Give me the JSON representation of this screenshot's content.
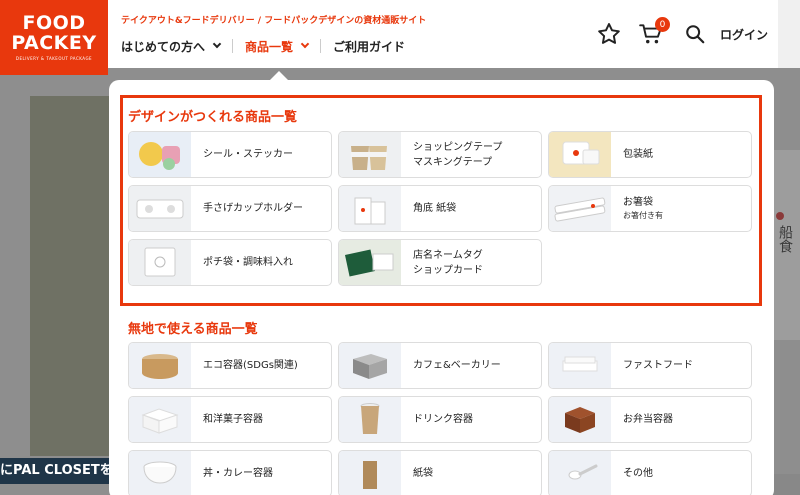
{
  "logo": {
    "line1": "FOOD",
    "line2": "PACKEY",
    "tagline": "DELIVERY & TAKEOUT PACKAGE"
  },
  "header": {
    "tagline": "テイクアウト&フードデリバリー / フードパックデザインの資材通販サイト",
    "nav": [
      {
        "label": "はじめての方へ",
        "has_chevron": true,
        "active": false
      },
      {
        "label": "商品一覧",
        "has_chevron": true,
        "active": true
      },
      {
        "label": "ご利用ガイド",
        "has_chevron": false,
        "active": false
      }
    ],
    "cart_count": "0",
    "login_label": "ログイン",
    "icons": {
      "favorite": "star-icon",
      "cart": "cart-icon",
      "search": "search-icon"
    }
  },
  "menu": {
    "design_title": "デザインがつくれる商品一覧",
    "design_items": [
      {
        "label": "シール・ステッカー"
      },
      {
        "label": "ショッピングテープ",
        "sub": "マスキングテープ"
      },
      {
        "label": "包装紙"
      },
      {
        "label": "手さげカップホルダー"
      },
      {
        "label": "角底 紙袋"
      },
      {
        "label": "お箸袋",
        "sub": "お箸付き有"
      },
      {
        "label": "ポチ袋・調味料入れ"
      },
      {
        "label": "店名ネームタグ",
        "sub": "ショップカード"
      }
    ],
    "plain_title": "無地で使える商品一覧",
    "plain_items": [
      {
        "label": "エコ容器(SDGs関連)"
      },
      {
        "label": "カフェ&ベーカリー"
      },
      {
        "label": "ファストフード"
      },
      {
        "label": "和洋菓子容器"
      },
      {
        "label": "ドリンク容器"
      },
      {
        "label": "お弁当容器"
      },
      {
        "label": "丼・カレー容器"
      },
      {
        "label": "紙袋"
      },
      {
        "label": "その他"
      }
    ]
  },
  "background": {
    "banner_text": "にPAL CLOSETを",
    "side_text": "船食"
  },
  "colors": {
    "brand": "#e8380d",
    "text": "#222222",
    "overlay": "#8e8e8e"
  }
}
